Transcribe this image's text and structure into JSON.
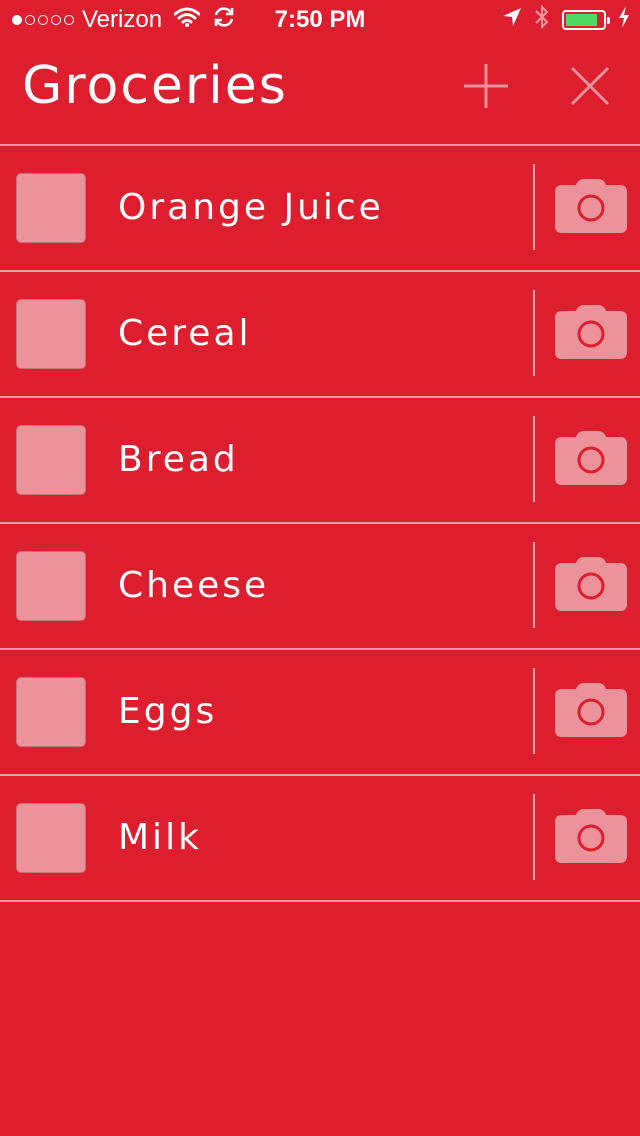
{
  "status_bar": {
    "carrier": "Verizon",
    "time": "7:50 PM",
    "signal_bars_filled": 1,
    "signal_bars_total": 5,
    "battery_level": 0.85,
    "battery_color": "#4CD964"
  },
  "header": {
    "title": "Groceries",
    "add_icon": "plus-icon",
    "close_icon": "close-icon"
  },
  "theme": {
    "background": "#DD1E2F",
    "checkbox_fill": "#EC929A",
    "icon_color": "#EC929A"
  },
  "items": [
    {
      "label": "Orange Juice",
      "checked": false,
      "icon": "camera-icon"
    },
    {
      "label": "Cereal",
      "checked": false,
      "icon": "camera-icon"
    },
    {
      "label": "Bread",
      "checked": false,
      "icon": "camera-icon"
    },
    {
      "label": "Cheese",
      "checked": false,
      "icon": "camera-icon"
    },
    {
      "label": "Eggs",
      "checked": false,
      "icon": "camera-icon"
    },
    {
      "label": "Milk",
      "checked": false,
      "icon": "camera-icon"
    }
  ]
}
